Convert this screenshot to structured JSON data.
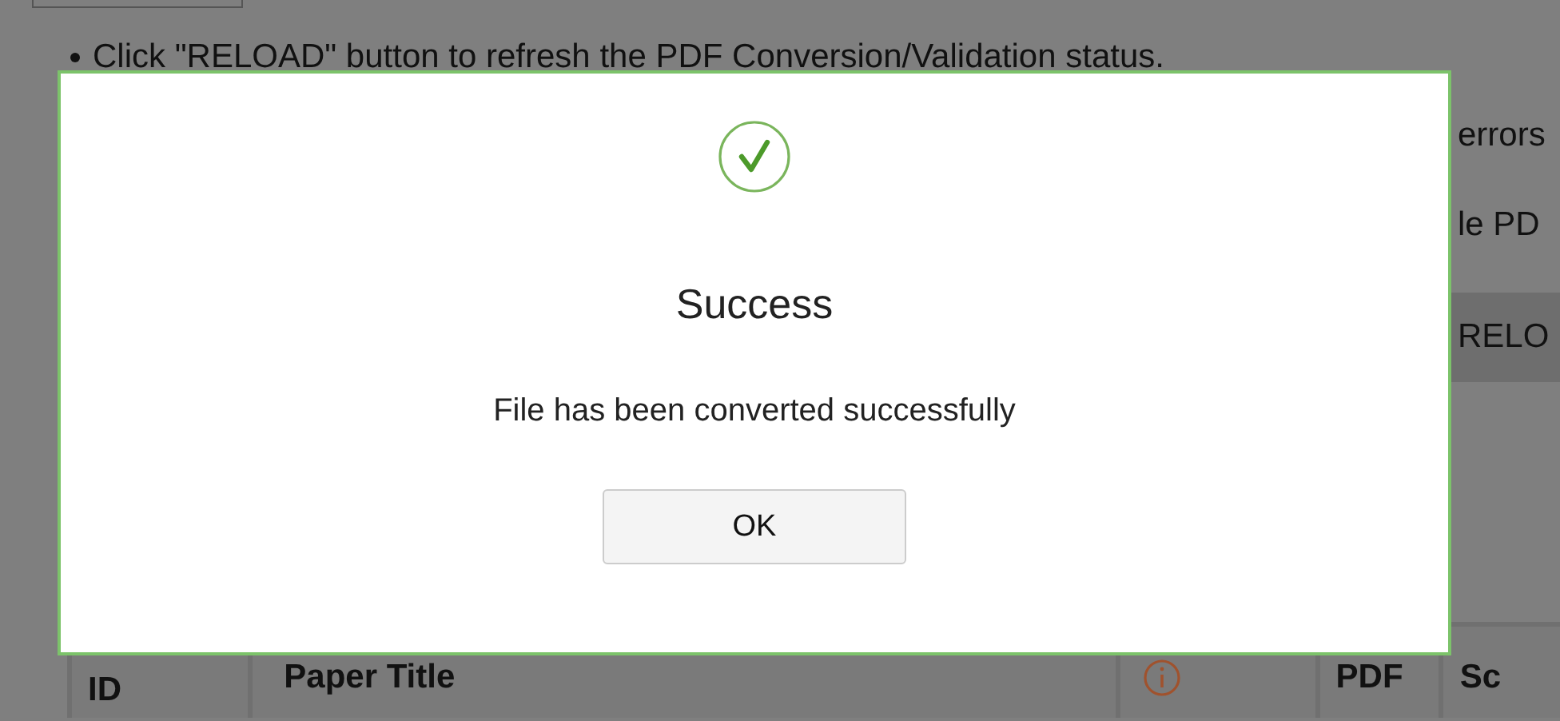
{
  "instructions": [
    {
      "text": "Click \"RELOAD\" button to refresh the PDF Conversion/Validation status."
    },
    {
      "text": "errors"
    },
    {
      "text": "le PD"
    }
  ],
  "reload_button": {
    "label": "RELO"
  },
  "table": {
    "columns": [
      {
        "label": "ID",
        "kind": "text"
      },
      {
        "label": "Paper Title",
        "kind": "text"
      },
      {
        "kind": "info"
      },
      {
        "label": "PDF",
        "kind": "text"
      },
      {
        "label": "Sc",
        "kind": "text"
      }
    ]
  },
  "dialog": {
    "kind": "success",
    "title": "Success",
    "message": "File has been converted successfully",
    "button": "OK"
  }
}
